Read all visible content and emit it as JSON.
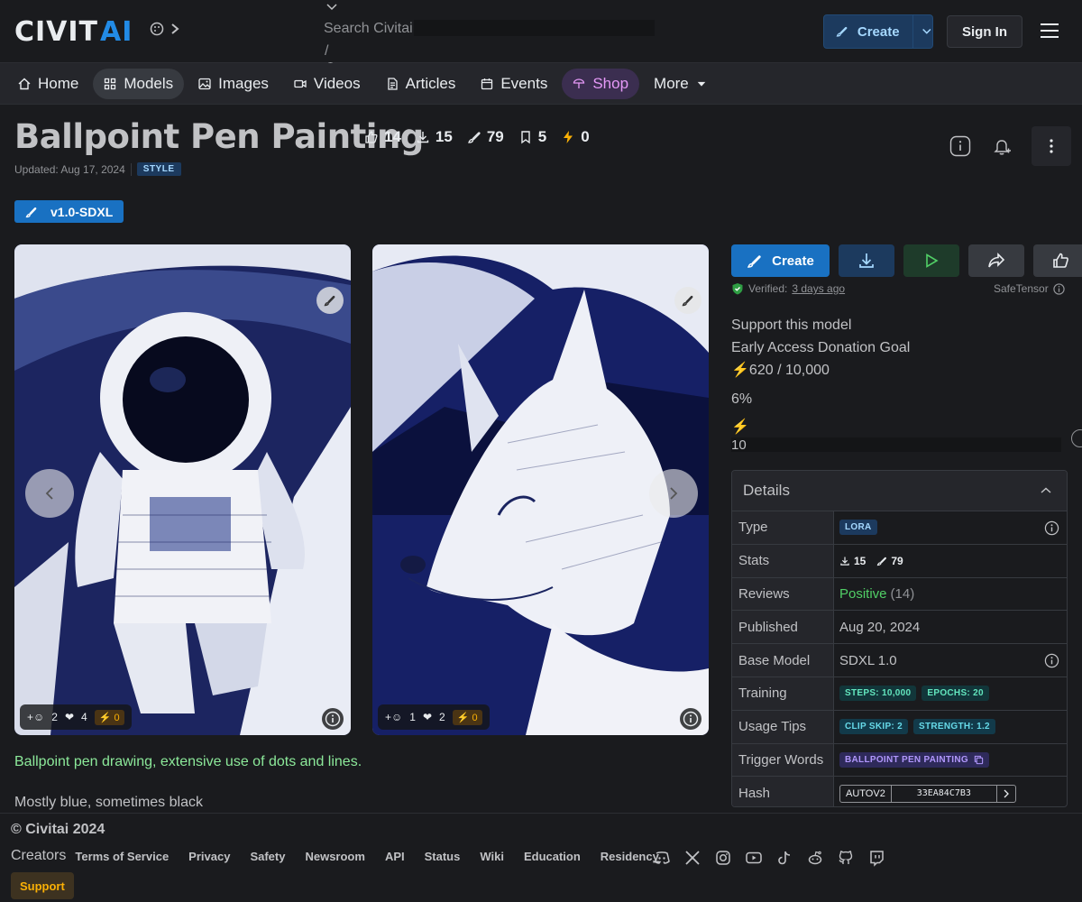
{
  "header": {
    "logo_a": "CIVIT",
    "logo_b": "AI",
    "search_placeholder": "Search Civitai",
    "search_shortcut": "/",
    "create_label": "Create",
    "signin_label": "Sign In"
  },
  "nav": {
    "items": [
      {
        "label": "Home",
        "icon": "home-icon"
      },
      {
        "label": "Models",
        "icon": "grid-icon"
      },
      {
        "label": "Images",
        "icon": "image-icon"
      },
      {
        "label": "Videos",
        "icon": "video-icon"
      },
      {
        "label": "Articles",
        "icon": "article-icon"
      },
      {
        "label": "Events",
        "icon": "calendar-icon"
      },
      {
        "label": "Shop",
        "icon": "shirt-icon"
      },
      {
        "label": "More",
        "icon": "caret-down-icon"
      }
    ]
  },
  "model": {
    "title": "Ballpoint Pen Painting",
    "stats": {
      "likes": "14",
      "downloads": "15",
      "generations": "79",
      "bookmarks": "5",
      "buzz": "0"
    },
    "updated": "Updated: Aug 17, 2024",
    "category": "STYLE",
    "version": "v1.0-SDXL"
  },
  "gallery": [
    {
      "reactions": "2",
      "hearts": "4",
      "buzz": "0"
    },
    {
      "reactions": "1",
      "hearts": "2",
      "buzz": "0"
    }
  ],
  "description": {
    "line1": "Ballpoint pen drawing, extensive use of dots and lines.",
    "line2": "Mostly blue, sometimes black"
  },
  "actions": {
    "create_label": "Create",
    "verified_prefix": "Verified:",
    "verified_time": "3 days ago",
    "safetensor": "SafeTensor"
  },
  "support": {
    "title": "Support this model",
    "goal": "Early Access Donation Goal",
    "progress": "620 / 10,000",
    "percent": "6%",
    "amount": "10"
  },
  "details": {
    "heading": "Details",
    "type_label": "Type",
    "type_value": "LORA",
    "stats_label": "Stats",
    "stats_downloads": "15",
    "stats_generations": "79",
    "reviews_label": "Reviews",
    "reviews_value": "Positive",
    "reviews_count": "(14)",
    "published_label": "Published",
    "published_value": "Aug 20, 2024",
    "base_label": "Base Model",
    "base_value": "SDXL 1.0",
    "training_label": "Training",
    "training_steps": "STEPS: 10,000",
    "training_epochs": "EPOCHS: 20",
    "usage_label": "Usage Tips",
    "usage_clip": "CLIP SKIP: 2",
    "usage_strength": "STRENGTH: 1.2",
    "trigger_label": "Trigger Words",
    "trigger_value": "BALLPOINT PEN PAINTING",
    "hash_label": "Hash",
    "hash_type": "AUTOV2",
    "hash_value": "33EA84C7B3"
  },
  "footer": {
    "copyright": "© Civitai 2024",
    "links": [
      "Creators",
      "Terms of Service",
      "Privacy",
      "Safety",
      "Newsroom",
      "API",
      "Status",
      "Wiki",
      "Education",
      "Residency"
    ],
    "support_label": "Support"
  },
  "colors": {
    "accent": "#1971c2",
    "buzz": "#fab005",
    "positive": "#51cf66",
    "description": "#8ce99a"
  }
}
